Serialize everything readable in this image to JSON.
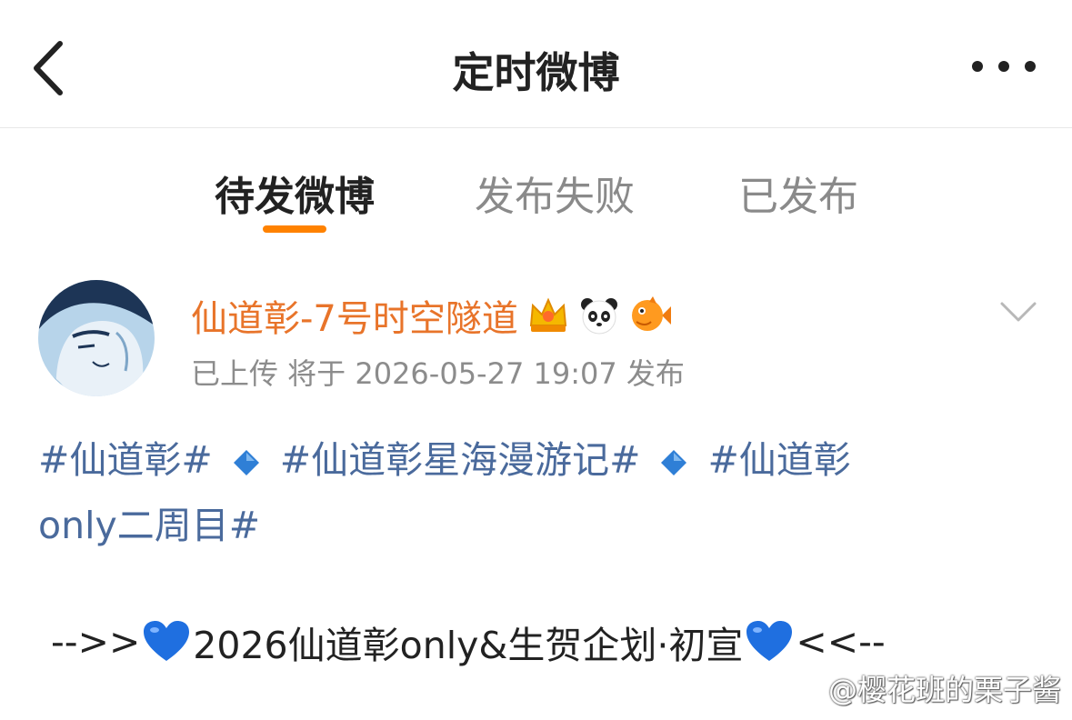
{
  "header": {
    "title": "定时微博"
  },
  "tabs": [
    {
      "label": "待发微博",
      "active": true
    },
    {
      "label": "发布失败",
      "active": false
    },
    {
      "label": "已发布",
      "active": false
    }
  ],
  "post": {
    "username": "仙道彰-7号时空隧道",
    "badges": [
      "crown-badge-icon",
      "panda-emoji-icon",
      "fish-emoji-icon"
    ],
    "meta": "已上传 将于 2026-05-27 19:07 发布",
    "tags": {
      "tag1": "#仙道彰#",
      "tag2": "#仙道彰星海漫游记#",
      "tag3a": "#仙道彰",
      "tag3b": "only二周目#"
    },
    "separator_icon": "blue-diamond-icon",
    "announcement": {
      "prefix": "-->>",
      "text": "2026仙道彰only&生贺企划·初宣",
      "suffix": "<<--",
      "heart_icon": "blue-heart-icon"
    }
  },
  "watermark": {
    "text": "@樱花班的栗子酱"
  },
  "colors": {
    "accent": "#ff8200",
    "username": "#e8742a",
    "topic": "#4a6a9c",
    "muted": "#8c8c8c",
    "diamond": "#2f7fd6",
    "heart": "#1f6fe0"
  }
}
